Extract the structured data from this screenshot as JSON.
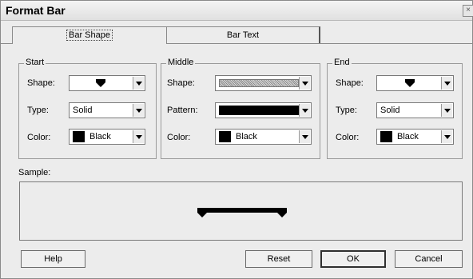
{
  "window": {
    "title": "Format Bar",
    "close_label": "×"
  },
  "tabs": [
    {
      "label": "Bar Shape",
      "active": true
    },
    {
      "label": "Bar Text",
      "active": false
    }
  ],
  "groups": {
    "start": {
      "title": "Start",
      "shape_label": "Shape:",
      "type_label": "Type:",
      "type_value": "Solid",
      "color_label": "Color:",
      "color_value": "Black"
    },
    "middle": {
      "title": "Middle",
      "shape_label": "Shape:",
      "pattern_label": "Pattern:",
      "color_label": "Color:",
      "color_value": "Black"
    },
    "end": {
      "title": "End",
      "shape_label": "Shape:",
      "type_label": "Type:",
      "type_value": "Solid",
      "color_label": "Color:",
      "color_value": "Black"
    }
  },
  "sample": {
    "label": "Sample:"
  },
  "buttons": {
    "help": "Help",
    "reset": "Reset",
    "ok": "OK",
    "cancel": "Cancel"
  },
  "colors": {
    "dialog_bg": "#ececec",
    "swatch_black": "#000000"
  }
}
